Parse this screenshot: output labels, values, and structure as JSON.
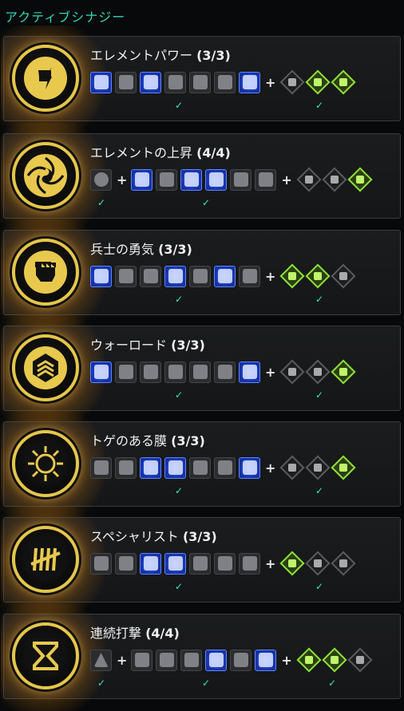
{
  "header": "アクティブシナジー",
  "synergies": [
    {
      "name": "エレメントパワー",
      "count": "(3/3)",
      "icon": "fist-lightning-icon",
      "items": [
        1,
        0,
        1,
        0,
        0,
        0,
        1
      ],
      "plus_items": [
        "green",
        "green",
        "green"
      ],
      "diamonds_gray": 1,
      "checks_items": [
        3
      ],
      "checks_diamonds": [
        1
      ]
    },
    {
      "name": "エレメントの上昇",
      "count": "(4/4)",
      "icon": "yin-yang-icon",
      "items": [
        0
      ],
      "after_plus": [
        1,
        0,
        1,
        1,
        0,
        0
      ],
      "plus_items": [
        "gray",
        "gray",
        "green"
      ],
      "checks": [
        0,
        4
      ]
    },
    {
      "name": "兵士の勇気",
      "count": "(3/3)",
      "icon": "fist-icon",
      "items": [
        1,
        0,
        0,
        1,
        0,
        1,
        0
      ],
      "plus_items": [
        "green",
        "green",
        "gray"
      ]
    },
    {
      "name": "ウォーロード",
      "count": "(3/3)",
      "icon": "chevron-rank-icon",
      "items": [
        1,
        0,
        0,
        0,
        0,
        0,
        1
      ],
      "plus_items": [
        "gray",
        "gray",
        "green"
      ]
    },
    {
      "name": "トゲのある膜",
      "count": "(3/3)",
      "icon": "sun-spikes-icon",
      "items": [
        0,
        0,
        1,
        1,
        0,
        0,
        1
      ],
      "plus_items": [
        "gray",
        "gray",
        "green"
      ]
    },
    {
      "name": "スペシャリスト",
      "count": "(3/3)",
      "icon": "tally-marks-icon",
      "items": [
        0,
        0,
        1,
        1,
        0,
        0,
        0
      ],
      "plus_items": [
        "green",
        "gray",
        "gray"
      ]
    },
    {
      "name": "連続打撃",
      "count": "(4/4)",
      "icon": "hourglass-icon",
      "items": [
        0
      ],
      "after_plus": [
        0,
        0,
        0,
        1,
        0,
        1
      ],
      "plus_items": [
        "green",
        "green",
        "gray"
      ]
    }
  ],
  "check_mark": "✓",
  "plus_sign": "+"
}
